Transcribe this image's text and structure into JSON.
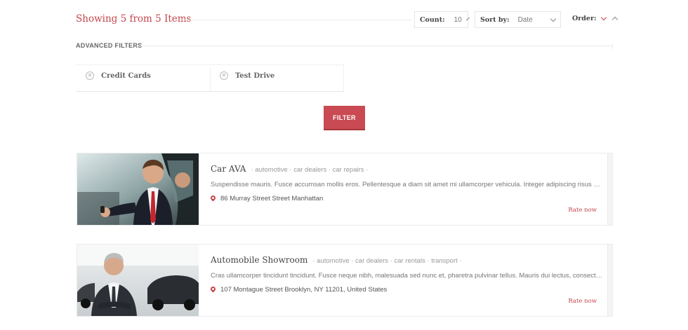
{
  "header": {
    "showing_text": "Showing 5 from 5 Items",
    "count_label": "Count:",
    "count_value": "10",
    "sort_label": "Sort by:",
    "sort_value": "Date",
    "order_label": "Order:"
  },
  "filters": {
    "title": "ADVANCED FILTERS",
    "chips": [
      {
        "label": "Credit Cards"
      },
      {
        "label": "Test Drive"
      }
    ],
    "button_label": "FILTER"
  },
  "listings": [
    {
      "title": "Car AVA",
      "categories": "· automotive · car dealers · car repairs ·",
      "description": "Suspendisse mauris. Fusce accumsan mollis eros. Pellentesque a diam sit amet mi ullamcorper vehicula. Integer adipiscing risus a sem...",
      "address": "86 Murray Street Street Manhattan",
      "rate_label": "Rate now"
    },
    {
      "title": "Automobile Showroom",
      "categories": "· automotive · car dealers · car rentals · transport ·",
      "description": "Cras ullamcorper tincidunt tincidunt. Fusce neque nibh, malesuada sed nunc et, pharetra pulvinar tellus. Mauris dui lectus, consectetur...",
      "address": "107 Montague Street Brooklyn, NY 11201, United States",
      "rate_label": "Rate now"
    }
  ],
  "colors": {
    "accent": "#c4444b",
    "button": "#c94a52"
  }
}
